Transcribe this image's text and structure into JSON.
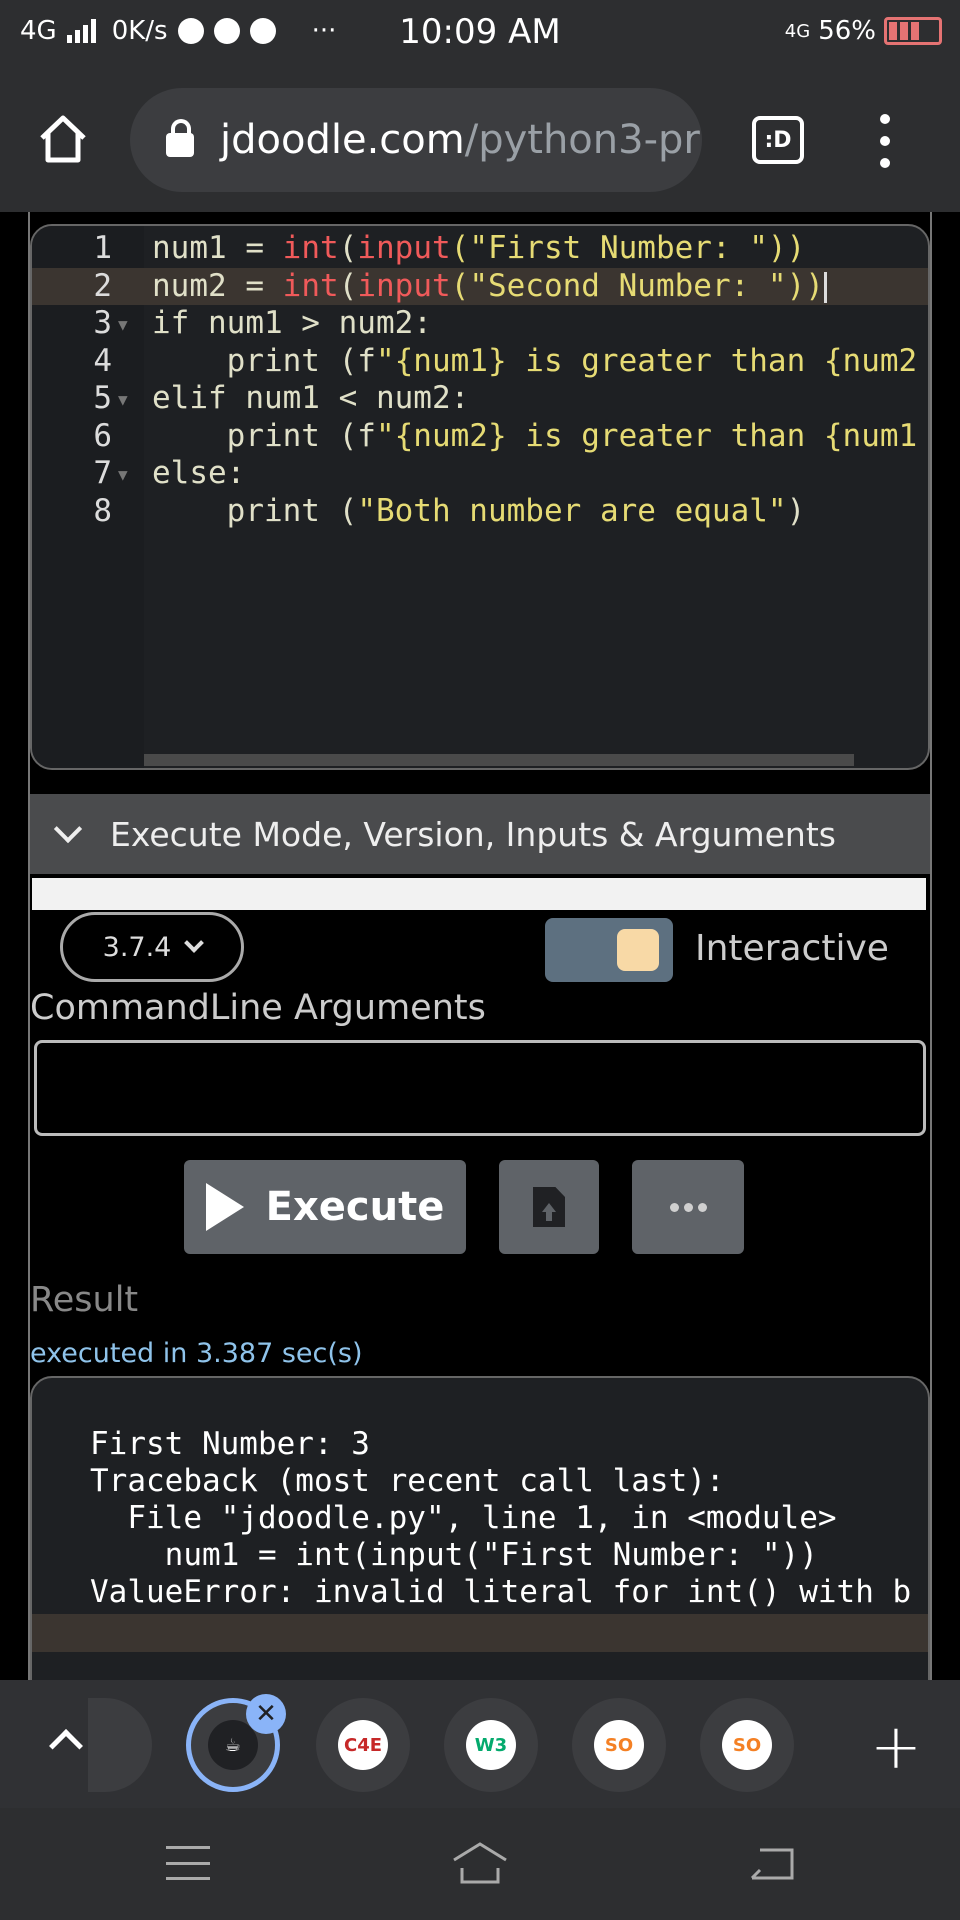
{
  "status_bar": {
    "network": "4G",
    "speed": "0K/s",
    "more": "···",
    "time": "10:09 AM",
    "network_right": "4G",
    "battery": "56%"
  },
  "browser": {
    "url_domain": "jdoodle.com",
    "url_path": "/python3-pr",
    "tab_switcher_label": ":D"
  },
  "editor": {
    "lines": [
      {
        "num": "1",
        "parts": [
          [
            "num1 = ",
            "kw"
          ],
          [
            "int",
            "fn"
          ],
          [
            "(",
            "kw"
          ],
          [
            "input",
            "fn"
          ],
          [
            "(\"First Number: \"))",
            "str"
          ]
        ]
      },
      {
        "num": "2",
        "parts": [
          [
            "num2 = ",
            "kw"
          ],
          [
            "int",
            "fn"
          ],
          [
            "(",
            "kw"
          ],
          [
            "input",
            "fn"
          ],
          [
            "(\"Second Number: \"))",
            "str"
          ]
        ]
      },
      {
        "num": "3",
        "parts": [
          [
            "if num1 > num2:",
            "kw"
          ]
        ]
      },
      {
        "num": "4",
        "parts": [
          [
            "    print (f",
            "kw"
          ],
          [
            "\"{num1} is greater than {num2",
            "str"
          ]
        ]
      },
      {
        "num": "5",
        "parts": [
          [
            "elif num1 < num2:",
            "kw"
          ]
        ]
      },
      {
        "num": "6",
        "parts": [
          [
            "    print (f",
            "kw"
          ],
          [
            "\"{num2} is greater than {num1",
            "str"
          ]
        ]
      },
      {
        "num": "7",
        "parts": [
          [
            "else:",
            "kw"
          ]
        ]
      },
      {
        "num": "8",
        "parts": [
          [
            "    print (",
            "kw"
          ],
          [
            "\"Both number are equal\"",
            "str"
          ],
          [
            ")",
            "kw"
          ]
        ]
      }
    ]
  },
  "execute_section": {
    "header": "Execute Mode, Version, Inputs & Arguments",
    "version": "3.7.4",
    "interactive_label": "Interactive",
    "cmd_label": "CommandLine Arguments",
    "cmd_value": "",
    "execute_label": "Execute"
  },
  "result": {
    "label": "Result",
    "exec_time": "executed in 3.387 sec(s)",
    "output": [
      "First Number: 3",
      "Traceback (most recent call last):",
      "  File \"jdoodle.py\", line 1, in <module>",
      "    num1 = int(input(\"First Number: \"))",
      "ValueError: invalid literal for int() with b"
    ]
  },
  "tabs": {
    "close": "✕",
    "add": "+",
    "items": [
      "jdoodle",
      "C4E",
      "W3",
      "SO",
      "SO"
    ]
  },
  "colors": {
    "accent": "#8ab4f8",
    "error_keyword": "#f05a5a",
    "string": "#e6db74"
  }
}
